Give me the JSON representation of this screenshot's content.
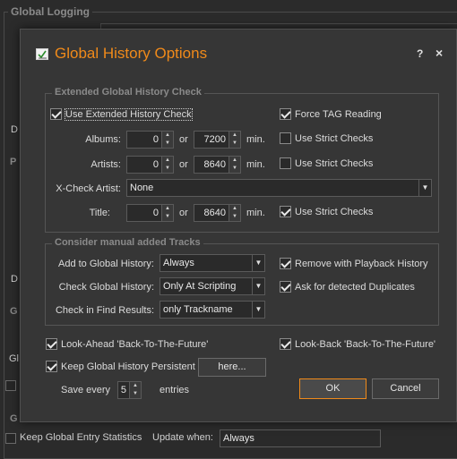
{
  "background": {
    "global_logging_title": "Global Logging",
    "p_label": "P",
    "d_label_1": "D",
    "d_label_2": "D",
    "g_label_1": "G",
    "g_label_2": "G",
    "gl_label": "Gl",
    "keep_stats_label": "Keep Global Entry Statistics",
    "update_when_label": "Update when:",
    "update_when_value": "Always"
  },
  "dialog": {
    "title": "Global History Options",
    "help": "?",
    "close": "×"
  },
  "extended": {
    "group_title": "Extended Global History Check",
    "use_extended": "Use Extended History Check",
    "force_tag": "Force TAG Reading",
    "albums_label": "Albums:",
    "albums_from": "0",
    "albums_to": "7200",
    "artists_label": "Artists:",
    "artists_from": "0",
    "artists_to": "8640",
    "title_label": "Title:",
    "title_from": "0",
    "title_to": "8640",
    "or": "or",
    "min": "min.",
    "strict": "Use Strict Checks",
    "xcheck_label": "X-Check Artist:",
    "xcheck_value": "None"
  },
  "manual": {
    "group_title": "Consider manual added Tracks",
    "add_label": "Add to Global History:",
    "add_value": "Always",
    "check_label": "Check Global History:",
    "check_value": "Only At Scripting",
    "find_label": "Check in Find Results:",
    "find_value": "only Trackname",
    "remove_playback": "Remove with Playback History",
    "ask_duplicates": "Ask for detected Duplicates"
  },
  "bottom": {
    "look_ahead": "Look-Ahead 'Back-To-The-Future'",
    "look_back": "Look-Back 'Back-To-The-Future'",
    "keep_persistent": "Keep Global History Persistent",
    "here_button": "here...",
    "save_every": "Save every",
    "save_value": "5",
    "entries": "entries",
    "ok": "OK",
    "cancel": "Cancel"
  },
  "colors": {
    "accent": "#f08a1a",
    "background": "#363636"
  }
}
